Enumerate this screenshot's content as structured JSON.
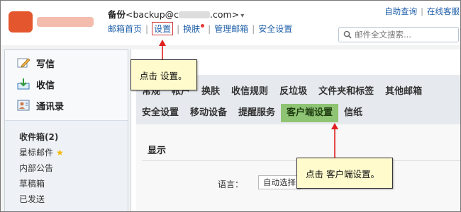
{
  "account": {
    "prefix": "备份",
    "address": "<backup@c",
    "address_tail": ".com>",
    "dropdown_glyph": "▾"
  },
  "nav": {
    "items": [
      "邮箱首页",
      "设置",
      "换肤",
      "管理邮箱",
      "安全设置"
    ],
    "separator": "|",
    "active_index": 1
  },
  "top_links": {
    "help": "自助查询",
    "separator": "|",
    "online": "在线客服"
  },
  "search": {
    "placeholder": "邮件全文搜索..."
  },
  "sidebar": {
    "actions": [
      {
        "label": "写信",
        "icon": "compose-icon"
      },
      {
        "label": "收信",
        "icon": "receive-icon"
      },
      {
        "label": "通讯录",
        "icon": "contacts-icon"
      }
    ],
    "folders": [
      {
        "label": "收件箱(2)"
      },
      {
        "label": "星标邮件",
        "star": "★"
      },
      {
        "label": "内部公告"
      },
      {
        "label": "草稿箱"
      },
      {
        "label": "已发送"
      }
    ]
  },
  "tabs": {
    "row1": [
      "常规",
      "帐户",
      "换肤",
      "收信规则",
      "反垃圾",
      "文件夹和标签",
      "其他邮箱"
    ],
    "row2": [
      "安全设置",
      "移动设备",
      "提醒服务",
      "客户端设置",
      "信纸"
    ],
    "active_row2_index": 3
  },
  "content": {
    "section_title": "显示",
    "language_label": "语言：",
    "language_value": "自动选择"
  },
  "callouts": {
    "first": "点击 设置。",
    "second": "点击 客户端设置。"
  },
  "colors": {
    "link": "#1f5fa9",
    "active_tab": "#8fc474",
    "highlight_box": "#d13a3a",
    "callout_bg": "#fffbcc",
    "arrow": "#e02020"
  }
}
